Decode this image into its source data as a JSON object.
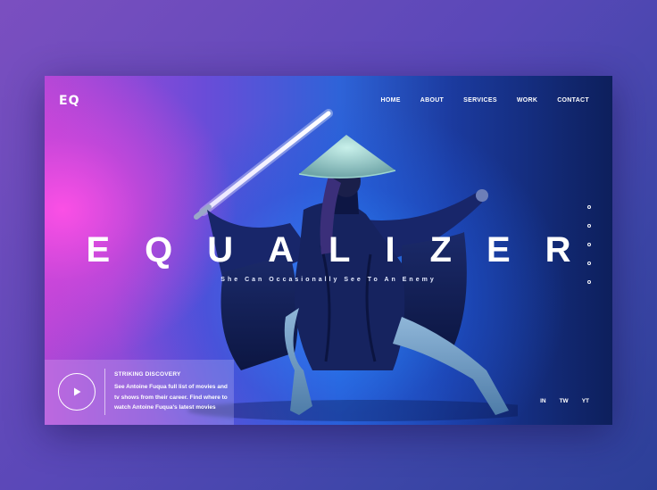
{
  "logo": {
    "text": "EQ"
  },
  "nav": {
    "items": [
      "HOME",
      "ABOUT",
      "SERVICES",
      "WORK",
      "CONTACT"
    ]
  },
  "hero": {
    "title": "EQUALIZER",
    "subtitle": "She Can Occasionally See To An Enemy"
  },
  "pager": {
    "count": 5
  },
  "feature": {
    "title": "STRIKING DISCOVERY",
    "text": "See Antoine Fuqua full list of movies and tv shows from their career. Find where to watch Antoine Fuqua's latest movies",
    "play_icon": "play-icon"
  },
  "social": {
    "items": [
      "IN",
      "TW",
      "YT"
    ]
  },
  "colors": {
    "background": "#5a48b8",
    "accent_pink": "#ff50e6",
    "accent_blue": "#2e63d8",
    "text": "#ffffff"
  }
}
